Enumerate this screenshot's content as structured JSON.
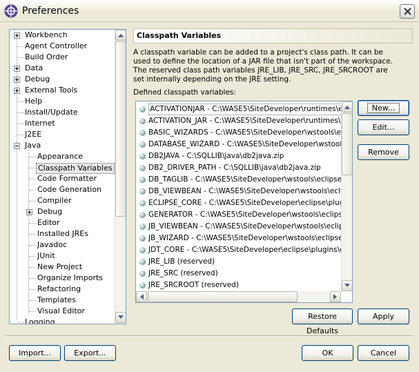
{
  "window": {
    "title": "Preferences"
  },
  "tree": {
    "items": [
      {
        "label": "Workbench",
        "expander": "plus"
      },
      {
        "label": "Agent Controller"
      },
      {
        "label": "Build Order"
      },
      {
        "label": "Data",
        "expander": "plus"
      },
      {
        "label": "Debug",
        "expander": "plus"
      },
      {
        "label": "External Tools",
        "expander": "plus"
      },
      {
        "label": "Help"
      },
      {
        "label": "Install/Update"
      },
      {
        "label": "Internet"
      },
      {
        "label": "J2EE"
      },
      {
        "label": "Java",
        "expander": "minus"
      },
      {
        "label": "Appearance"
      },
      {
        "label": "Classpath Variables",
        "selected": true
      },
      {
        "label": "Code Formatter"
      },
      {
        "label": "Code Generation"
      },
      {
        "label": "Compiler"
      },
      {
        "label": "Debug",
        "expander": "plus"
      },
      {
        "label": "Editor"
      },
      {
        "label": "Installed JREs"
      },
      {
        "label": "Javadoc"
      },
      {
        "label": "JUnit"
      },
      {
        "label": "New Project"
      },
      {
        "label": "Organize Imports"
      },
      {
        "label": "Refactoring"
      },
      {
        "label": "Templates"
      },
      {
        "label": "Visual Editor"
      },
      {
        "label": "Logging"
      }
    ]
  },
  "panel": {
    "title": "Classpath Variables",
    "description": "A classpath variable can be added to a project's class path. It can be used to define the location of a JAR file that isn't part of the workspace. The reserved class path variables JRE_LIB, JRE_SRC, JRE_SRCROOT are set internally depending on the JRE setting.",
    "defined_label": "Defined classpath variables:",
    "variables": [
      "ACTIVATIONJAR - C:\\WASE5\\SiteDeveloper\\runtimes\\exp",
      "ACTIVATION_JAR - C:\\WASE5\\SiteDeveloper\\runtimes\\ex",
      "BASIC_WIZARDS - C:\\WASE5\\SiteDeveloper\\wstools\\eclip",
      "DATABASE_WIZARD - C:\\WASE5\\SiteDeveloper\\wstools\\e",
      "DB2JAVA - C:\\SQLLIB\\java\\db2java.zip",
      "DB2_DRIVER_PATH - C:\\SQLLIB\\java\\db2java.zip",
      "DB_TAGLIB - C:\\WASE5\\SiteDeveloper\\wstools\\eclipse\\pl",
      "DB_VIEWBEAN - C:\\WASE5\\SiteDeveloper\\wstools\\eclipse",
      "ECLIPSE_CORE - C:\\WASE5\\SiteDeveloper\\eclipse\\plugins",
      "GENERATOR - C:\\WASE5\\SiteDeveloper\\wstools\\eclipse\\p",
      "JB_VIEWBEAN - C:\\WASE5\\SiteDeveloper\\wstools\\eclipse\\",
      "JB_WIZARD - C:\\WASE5\\SiteDeveloper\\wstools\\eclipse\\pl",
      "JDT_CORE - C:\\WASE5\\SiteDeveloper\\eclipse\\plugins\\org.",
      "JRE_LIB (reserved)",
      "JRE_SRC (reserved)",
      "JRE_SRCROOT (reserved)"
    ],
    "buttons": {
      "new": "New...",
      "edit": "Edit...",
      "remove": "Remove",
      "restore_defaults": "Restore Defaults",
      "apply": "Apply"
    }
  },
  "footer": {
    "import": "Import...",
    "export": "Export...",
    "ok": "OK",
    "cancel": "Cancel"
  }
}
